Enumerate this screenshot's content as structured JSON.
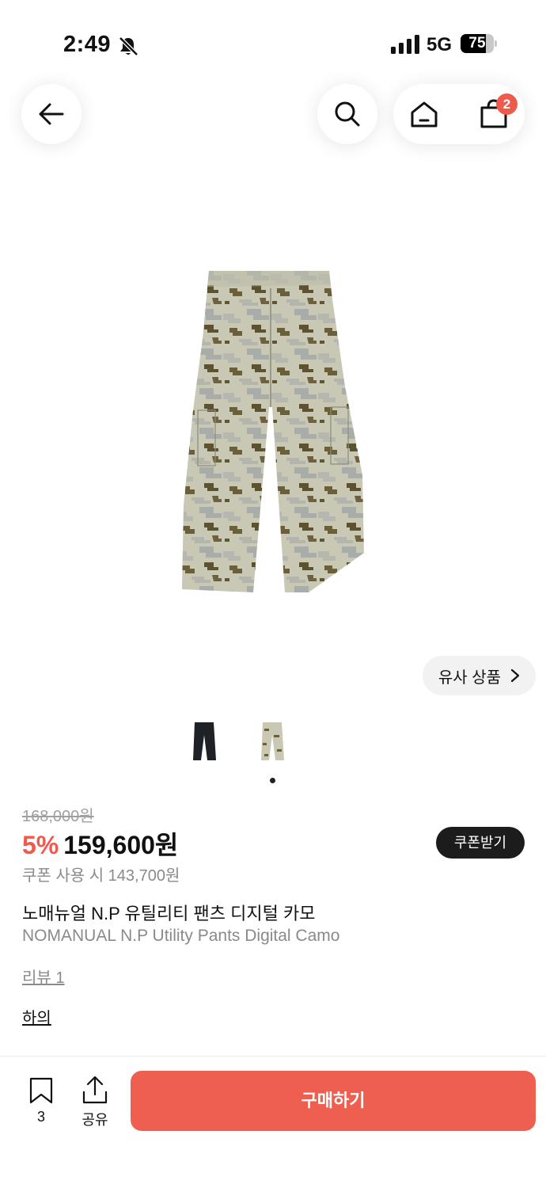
{
  "status_bar": {
    "time": "2:49",
    "network": "5G",
    "battery_level": "75",
    "battery_fraction": 0.75
  },
  "nav": {
    "cart_badge": "2"
  },
  "product": {
    "similar_label": "유사 상품",
    "original_price": "168,000원",
    "discount": "5%",
    "price": "159,600원",
    "coupon_button": "쿠폰받기",
    "coupon_price": "쿠폰 사용 시 143,700원",
    "title_ko": "노매뉴얼 N.P 유틸리티 팬츠 디지털 카모",
    "title_en": "NOMANUAL N.P Utility Pants Digital Camo",
    "review_link": "리뷰 1",
    "category_link": "하의"
  },
  "bottom_bar": {
    "bookmark_count": "3",
    "share_label": "공유",
    "buy_button": "구매하기"
  },
  "colors": {
    "accent": "#ef5f4f",
    "badge": "#ef5a4c",
    "coupon_button_bg": "#1c1c1c"
  }
}
